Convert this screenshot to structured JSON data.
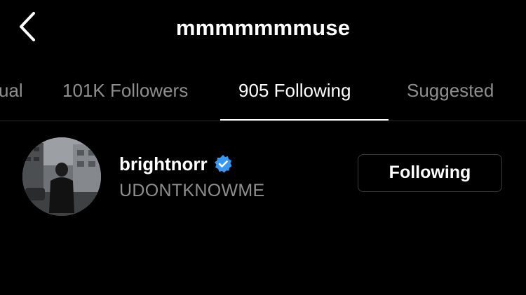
{
  "header": {
    "title": "mmmmmmmuse",
    "back_icon": "chevron-left-icon"
  },
  "tabs": [
    {
      "label": "ual",
      "active": false
    },
    {
      "label": "101K Followers",
      "active": false
    },
    {
      "label": "905 Following",
      "active": true
    },
    {
      "label": "Suggested",
      "active": false
    }
  ],
  "list": {
    "items": [
      {
        "username": "brightnorr",
        "verified": true,
        "full_name": "UDONTKNOWME",
        "button_label": "Following"
      }
    ]
  },
  "colors": {
    "background": "#000000",
    "primary_text": "#ffffff",
    "secondary_text": "#8e8e8e",
    "verified_badge": "#3897f0",
    "button_border": "#3a3a3a"
  }
}
